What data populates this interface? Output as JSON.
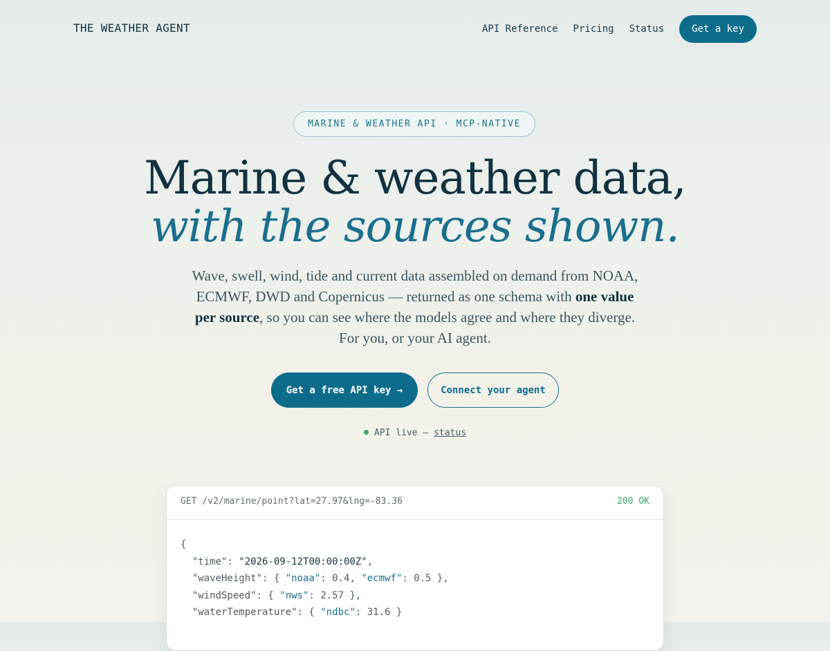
{
  "nav": {
    "brand": "THE WEATHER AGENT",
    "links": [
      "API Reference",
      "Pricing",
      "Status"
    ],
    "cta": "Get a key"
  },
  "hero": {
    "badge": "MARINE & WEATHER API · MCP-NATIVE",
    "title_line1": "Marine & weather data,",
    "title_line2": "with the sources shown.",
    "lede_part1": "Wave, swell, wind, tide and current data assembled on demand from NOAA, ECMWF, DWD and Copernicus — returned as one schema with ",
    "lede_bold": "one value per source",
    "lede_part2": ", so you can see where the models agree and where they diverge. For you, or your AI agent.",
    "primary_button": "Get a free API key →",
    "secondary_button": "Connect your agent",
    "status_text": "API live — ",
    "status_link": "status"
  },
  "example": {
    "request": "GET /v2/marine/point?lat=27.97&lng=-83.36",
    "response_status": "200 OK",
    "json": {
      "open": "{",
      "time_key": "\"time\"",
      "time_value": "\"2026-09-12T00:00:00Z\"",
      "wave_key": "\"waveHeight\"",
      "wave_noaa_key": "\"noaa\"",
      "wave_noaa_val": "0.4",
      "wave_ecmwf_key": "\"ecmwf\"",
      "wave_ecmwf_val": "0.5",
      "wind_key": "\"windSpeed\"",
      "wind_nws_key": "\"nws\"",
      "wind_nws_val": "2.57",
      "water_key": "\"waterTemperature\"",
      "water_ndbc_key": "\"ndbc\"",
      "water_ndbc_val": "31.6"
    }
  },
  "colors": {
    "accent": "#0e6c8b",
    "ink": "#13323f",
    "ok": "#3aa66a"
  }
}
